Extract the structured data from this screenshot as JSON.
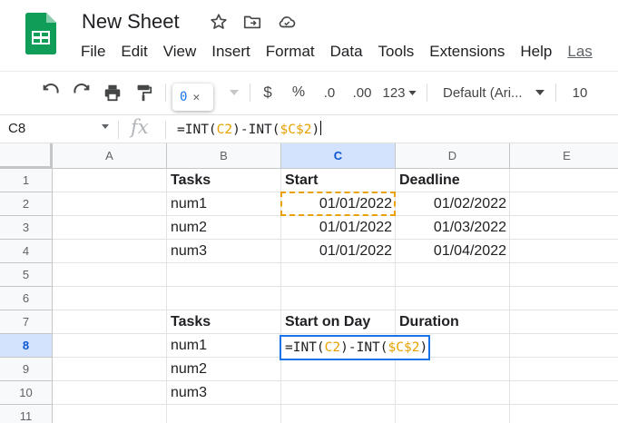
{
  "app": {
    "doc_title": "New Sheet",
    "menus": [
      "File",
      "Edit",
      "View",
      "Insert",
      "Format",
      "Data",
      "Tools",
      "Extensions",
      "Help",
      "Las"
    ]
  },
  "toolbar": {
    "currency": "$",
    "percent": "%",
    "dec_decrease": ".0",
    "dec_increase": ".00",
    "more_formats": "123",
    "font": "Default (Ari...",
    "font_size": "10",
    "tooltip_value": "0",
    "tooltip_close": "✕"
  },
  "formula_bar": {
    "name_box": "C8",
    "fx": "fx",
    "formula_start": "=INT(",
    "ref1": "C2",
    "formula_mid": ")-INT(",
    "ref2": "$C$2",
    "formula_end": ")"
  },
  "columns": [
    "A",
    "B",
    "C",
    "D",
    "E"
  ],
  "rows": [
    "1",
    "2",
    "3",
    "4",
    "5",
    "6",
    "7",
    "8",
    "9",
    "10",
    "11"
  ],
  "selection": {
    "col": "C",
    "row": "8"
  },
  "table1": {
    "headers": [
      "Tasks",
      "Start",
      "Deadline"
    ],
    "rows": [
      {
        "task": "num1",
        "start": "01/01/2022",
        "deadline": "01/02/2022"
      },
      {
        "task": "num2",
        "start": "01/01/2022",
        "deadline": "01/03/2022"
      },
      {
        "task": "num3",
        "start": "01/01/2022",
        "deadline": "01/04/2022"
      }
    ]
  },
  "table2": {
    "headers": [
      "Tasks",
      "Start on Day",
      "Duration"
    ],
    "tasks": [
      "num1",
      "num2",
      "num3"
    ]
  },
  "colors": {
    "sheets_green": "#0f9d58",
    "accent_blue": "#1a73e8",
    "reference_orange": "#e8a100"
  }
}
